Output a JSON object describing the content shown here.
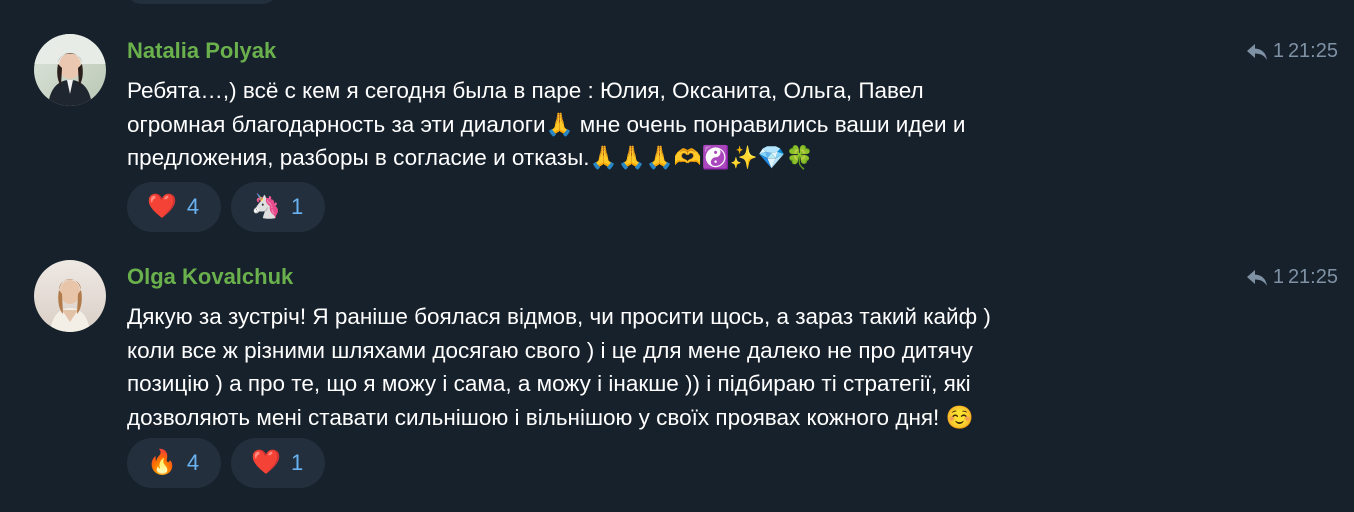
{
  "messages": [
    {
      "author": "Natalia Polyak",
      "reply_count": "1",
      "time": "21:25",
      "lines": [
        "Ребята…,) всё с кем я сегодня была в паре : Юлия, Оксанита, Ольга, Павел",
        "огромная благодарность за эти диалоги🙏 мне очень понравились ваши идеи и",
        "предложения, разборы  в согласие и отказы.🙏🙏🙏🫶☯️✨💎🍀"
      ],
      "reactions": [
        {
          "emoji": "❤️",
          "icon": "heart-icon",
          "count": "4"
        },
        {
          "emoji": "🦄",
          "icon": "unicorn-icon",
          "count": "1"
        }
      ]
    },
    {
      "author": "Olga Kovalchuk",
      "reply_count": "1",
      "time": "21:25",
      "lines": [
        "Дякую за зустріч! Я раніше боялася відмов, чи просити щось, а зараз такий кайф )",
        "коли все ж різними шляхами досягаю свого ) і це для мене далеко не про дитячу",
        "позицію ) а про те, що я можу і сама, а можу і інакше )) і підбираю ті стратегії, які",
        "дозволяють мені ставати сильнішою і вільнішою у своїх проявах кожного дня! ☺️"
      ],
      "reactions": [
        {
          "emoji": "🔥",
          "icon": "fire-icon",
          "count": "4"
        },
        {
          "emoji": "❤️",
          "icon": "heart-icon",
          "count": "1"
        }
      ]
    }
  ],
  "colors": {
    "background": "#17212b",
    "author": "#6ab04c",
    "reaction_bg": "#232f3c",
    "reaction_count": "#6ab3f3",
    "meta": "#7f91a4"
  }
}
